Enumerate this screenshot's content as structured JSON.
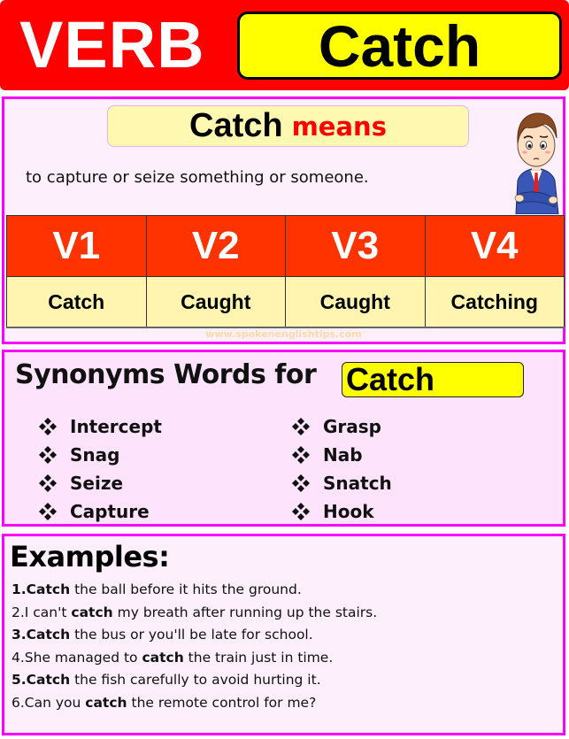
{
  "header": {
    "label": "VERB",
    "word": "Catch",
    "colors": {
      "background": "#ff0000",
      "word_box": "#ffff00"
    }
  },
  "meaning": {
    "word": "Catch",
    "label": "means",
    "definition": "to capture or seize something or someone.",
    "character_icon": "confused-businessman-illustration"
  },
  "verb_forms": {
    "headers": [
      "V1",
      "V2",
      "V3",
      "V4"
    ],
    "values": [
      "Catch",
      "Caught",
      "Caught",
      "Catching"
    ],
    "colors": {
      "header_bg": "#ff3300",
      "value_bg": "#fff5b0"
    }
  },
  "watermark": "www.spokenenglishtips.com",
  "synonyms": {
    "title": "Synonyms Words for",
    "word": "Catch",
    "bullet_icon": "four-diamond-bullet",
    "column1": [
      "Intercept",
      "Snag",
      "Seize",
      "Capture"
    ],
    "column2": [
      "Grasp",
      "Nab",
      "Snatch",
      "Hook"
    ]
  },
  "examples": {
    "title": "Examples:",
    "items": [
      {
        "prefix": "",
        "bold": "1.Catch",
        "rest": " the ball before it hits the ground."
      },
      {
        "prefix": "2.I can't ",
        "bold": "catch",
        "rest": " my breath after running up the stairs."
      },
      {
        "prefix": "",
        "bold": "3.Catch",
        "rest": " the bus or you'll be late for school."
      },
      {
        "prefix": "4.She managed to ",
        "bold": "catch",
        "rest": " the train just in time."
      },
      {
        "prefix": "",
        "bold": "5.Catch",
        "rest": " the fish carefully to avoid hurting it."
      },
      {
        "prefix": "6.Can you ",
        "bold": "catch",
        "rest": " the remote control for me?"
      }
    ]
  },
  "panel_border_color": "#ff00ff"
}
